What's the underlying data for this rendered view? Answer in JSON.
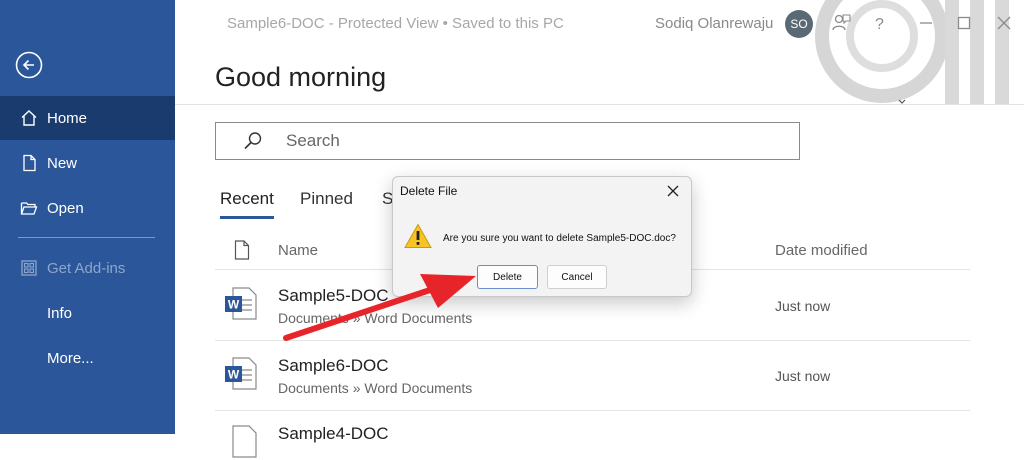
{
  "window": {
    "title": "Sample6-DOC  -  Protected View • Saved to this PC",
    "user_name": "Sodiq Olanrewaju",
    "avatar_initials": "SO"
  },
  "sidebar": {
    "items": [
      {
        "label": "Home",
        "icon": "home-icon",
        "active": true
      },
      {
        "label": "New",
        "icon": "new-document-icon"
      },
      {
        "label": "Open",
        "icon": "open-folder-icon"
      },
      {
        "label": "Get Add-ins",
        "icon": "add-ins-icon",
        "disabled": true
      },
      {
        "label": "Info"
      },
      {
        "label": "More..."
      }
    ]
  },
  "main": {
    "greeting": "Good morning",
    "search_placeholder": "Search",
    "tabs": [
      {
        "label": "Recent",
        "active": true
      },
      {
        "label": "Pinned"
      },
      {
        "label": "S"
      }
    ],
    "columns": {
      "name": "Name",
      "date": "Date modified"
    },
    "files": [
      {
        "name": "Sample5-DOC",
        "path": "Documents » Word Documents",
        "date": "Just now"
      },
      {
        "name": "Sample6-DOC",
        "path": "Documents » Word Documents",
        "date": "Just now"
      },
      {
        "name": "Sample4-DOC",
        "path": "",
        "date": ""
      }
    ]
  },
  "dialog": {
    "title": "Delete File",
    "message": "Are you sure you want to delete Sample5-DOC.doc?",
    "delete_label": "Delete",
    "cancel_label": "Cancel"
  },
  "colors": {
    "sidebar": "#2b579a",
    "sidebar_active": "#193b6e",
    "arrow": "#e8242b",
    "warning": "#f7c325"
  }
}
